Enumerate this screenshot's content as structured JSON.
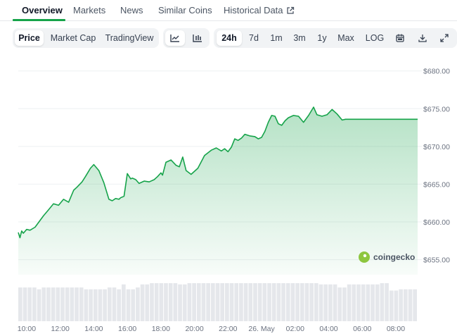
{
  "tabs": [
    {
      "label": "Overview",
      "active": true
    },
    {
      "label": "Markets"
    },
    {
      "label": "News"
    },
    {
      "label": "Similar Coins"
    },
    {
      "label": "Historical Data",
      "external": true
    }
  ],
  "toolbar": {
    "view_buttons": [
      "Price",
      "Market Cap",
      "TradingView"
    ],
    "chart_type_icons": [
      "line-chart-icon",
      "candlestick-icon"
    ],
    "range_buttons": [
      "24h",
      "7d",
      "1m",
      "3m",
      "1y",
      "Max",
      "LOG"
    ],
    "tool_icons": [
      "calendar-icon",
      "download-icon",
      "expand-icon"
    ],
    "active_view": "Price",
    "active_range": "24h"
  },
  "watermark": "coingecko",
  "colors": {
    "line": "#16a34a",
    "accent": "#16a34a",
    "volume": "#e5e7eb"
  },
  "chart_data": {
    "type": "area",
    "x_tick_labels": [
      "10:00",
      "12:00",
      "14:00",
      "16:00",
      "18:00",
      "20:00",
      "22:00",
      "26. May",
      "02:00",
      "04:00",
      "06:00",
      "08:00"
    ],
    "y_tick_labels": [
      "$680.00",
      "$675.00",
      "$670.00",
      "$665.00",
      "$660.00",
      "$655.00"
    ],
    "ylim": [
      653,
      681
    ],
    "x_hours_range": [
      -0.5,
      23.3
    ],
    "grid": true,
    "series": [
      {
        "x": [
          -0.5,
          -0.4,
          -0.3,
          -0.2,
          0.0,
          0.2,
          0.5,
          0.8,
          1.0,
          1.3,
          1.6,
          1.9,
          2.2,
          2.5,
          2.8,
          3.0,
          3.3,
          3.5,
          3.8,
          4.0,
          4.3,
          4.6,
          4.9,
          5.1,
          5.3,
          5.5,
          5.6,
          5.8,
          6.0,
          6.2,
          6.3,
          6.5,
          6.7,
          7.0,
          7.3,
          7.6,
          7.8,
          8.0,
          8.1,
          8.3,
          8.6,
          8.9,
          9.1,
          9.3,
          9.5,
          9.8,
          10.2,
          10.6,
          11.0,
          11.3,
          11.6,
          11.8,
          12.0,
          12.2,
          12.4,
          12.6,
          12.8,
          13.0,
          13.3,
          13.6,
          13.8,
          14.0,
          14.2,
          14.4,
          14.6,
          14.8,
          15.0,
          15.2,
          15.4,
          15.6,
          15.9,
          16.2,
          16.5,
          16.8,
          17.1,
          17.3,
          17.6,
          17.9,
          18.2,
          18.5,
          18.8,
          19.0,
          19.1,
          19.3,
          19.6,
          19.9,
          20.2,
          20.5,
          20.8,
          21.1,
          21.4,
          21.6,
          21.8,
          22.0,
          22.2,
          22.5,
          22.7,
          22.9,
          23.1,
          23.3
        ],
        "values": [
          658.6,
          657.9,
          658.8,
          658.5,
          659.0,
          658.9,
          659.3,
          660.2,
          660.8,
          661.6,
          662.4,
          662.2,
          663.0,
          662.6,
          664.2,
          664.6,
          665.3,
          666.0,
          667.1,
          667.6,
          666.8,
          665.2,
          663.0,
          662.8,
          663.1,
          663.0,
          663.2,
          663.4,
          666.4,
          665.7,
          665.8,
          665.6,
          665.1,
          665.4,
          665.3,
          665.6,
          666.0,
          666.5,
          666.2,
          667.9,
          668.2,
          667.5,
          667.3,
          668.6,
          666.8,
          666.3,
          667.1,
          668.8,
          669.5,
          669.8,
          669.4,
          669.7,
          669.3,
          669.9,
          671.0,
          670.8,
          671.1,
          671.6,
          671.4,
          671.3,
          671.0,
          671.2,
          672.0,
          673.2,
          674.1,
          674.0,
          673.0,
          672.8,
          673.4,
          673.8,
          674.1,
          674.0,
          673.2,
          674.1,
          675.2,
          674.2,
          674.0,
          674.2,
          674.9,
          674.3,
          673.5,
          673.6,
          673.6,
          673.6,
          673.6,
          673.6,
          673.6,
          673.6,
          673.6,
          673.6,
          673.6,
          673.6,
          673.6,
          673.6,
          673.6,
          673.6,
          673.6,
          673.6,
          673.6,
          673.6
        ]
      }
    ],
    "volume": [
      0.55,
      0.55,
      0.55,
      0.55,
      0.52,
      0.55,
      0.55,
      0.55,
      0.55,
      0.55,
      0.55,
      0.55,
      0.55,
      0.55,
      0.52,
      0.52,
      0.52,
      0.52,
      0.52,
      0.55,
      0.55,
      0.52,
      0.6,
      0.52,
      0.52,
      0.55,
      0.6,
      0.6,
      0.62,
      0.62,
      0.62,
      0.62,
      0.62,
      0.62,
      0.6,
      0.6,
      0.62,
      0.62,
      0.62,
      0.62,
      0.62,
      0.62,
      0.62,
      0.62,
      0.62,
      0.62,
      0.62,
      0.62,
      0.62,
      0.62,
      0.62,
      0.62,
      0.62,
      0.62,
      0.62,
      0.62,
      0.62,
      0.62,
      0.62,
      0.62,
      0.62,
      0.62,
      0.62,
      0.62,
      0.6,
      0.6,
      0.6,
      0.6,
      0.55,
      0.55,
      0.6,
      0.6,
      0.6,
      0.6,
      0.6,
      0.6,
      0.6,
      0.62,
      0.62,
      0.5,
      0.5,
      0.52,
      0.52,
      0.52,
      0.52
    ]
  }
}
